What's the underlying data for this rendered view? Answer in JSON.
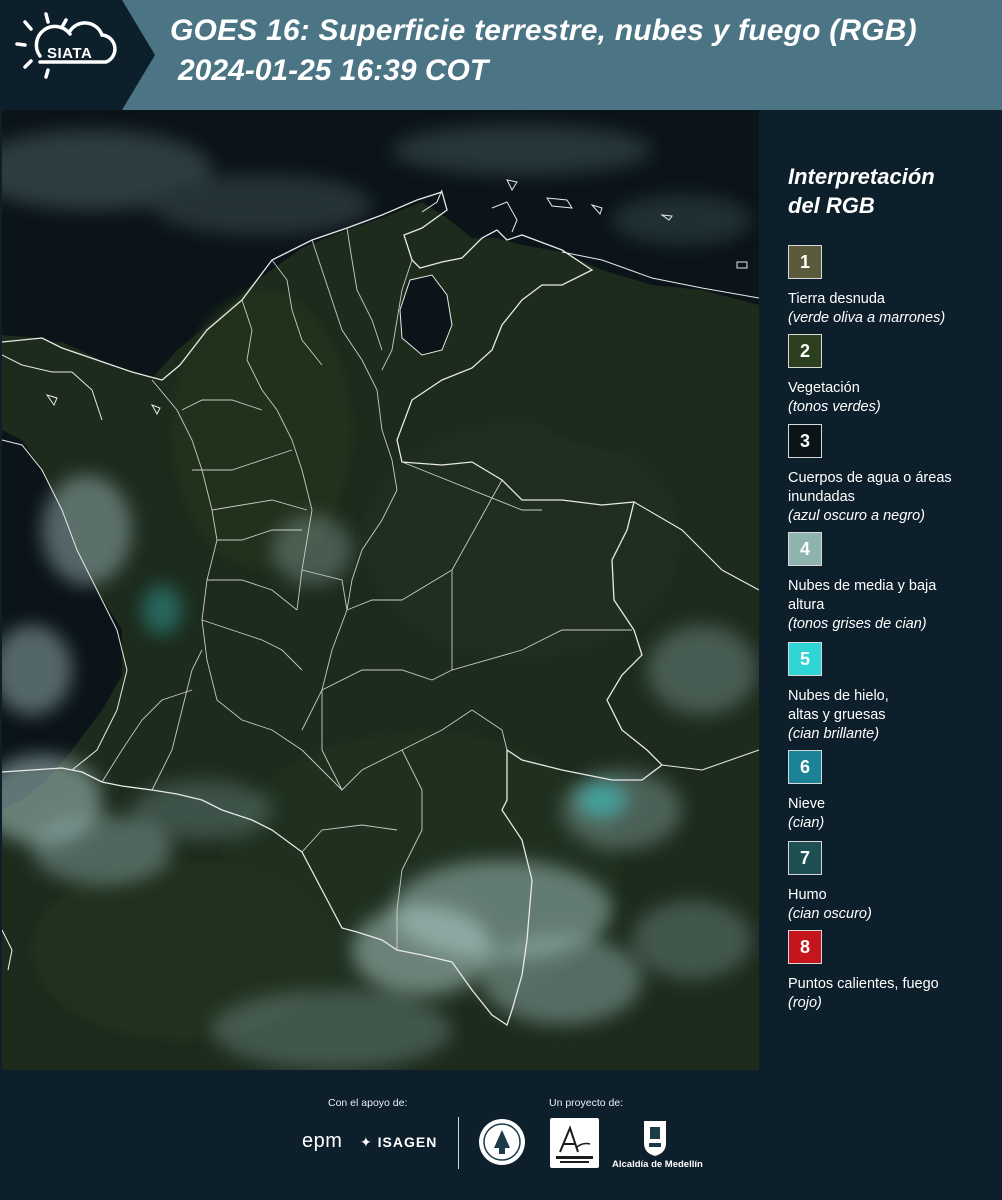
{
  "header": {
    "logo_text": "SIATA",
    "title": "GOES 16: Superficie terrestre, nubes y fuego (RGB)",
    "timestamp": "2024-01-25 16:39 COT"
  },
  "legend": {
    "title_line1": "Interpretación",
    "title_line2": "del RGB",
    "items": [
      {
        "number": "1",
        "label": "Tierra desnuda",
        "desc": "(verde oliva a marrones)",
        "color": "#5b5a3d"
      },
      {
        "number": "2",
        "label": "Vegetación",
        "desc": "(tonos verdes)",
        "color": "#2c3f1e"
      },
      {
        "number": "3",
        "label": "Cuerpos de agua o áreas inundadas",
        "desc": "(azul oscuro a negro)",
        "color": "#0b1418"
      },
      {
        "number": "4",
        "label": "Nubes de media y baja altura",
        "desc": "(tonos grises de cian)",
        "color": "#8fb4b0"
      },
      {
        "number": "5",
        "label": "Nubes de hielo, altas y gruesas",
        "desc": "(cian brillante)",
        "color": "#2fd5d5"
      },
      {
        "number": "6",
        "label": "Nieve",
        "desc": "(cian)",
        "color": "#1a8395"
      },
      {
        "number": "7",
        "label": "Humo",
        "desc": "(cian oscuro)",
        "color": "#1d4f53"
      },
      {
        "number": "8",
        "label": "Puntos calientes, fuego",
        "desc": "(rojo)",
        "color": "#c4161c"
      }
    ]
  },
  "footer": {
    "support_label": "Con el apoyo de:",
    "project_label": "Un proyecto de:",
    "epm": "epm",
    "isagen": "ISAGEN",
    "alcaldia": "Alcaldía de Medellín"
  },
  "colors": {
    "header_bg": "#4b7485",
    "logo_bg": "#0d1f2b",
    "panel_bg": "#0d1f2b",
    "land": "#1c2b1c",
    "ocean": "#0b1418",
    "cloud": "#8fb4b0",
    "border": "#e8e8e8"
  }
}
